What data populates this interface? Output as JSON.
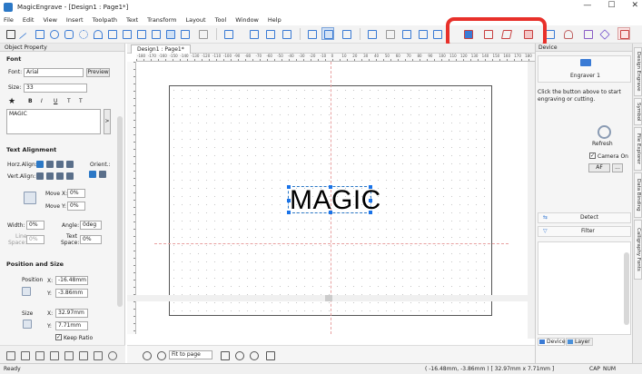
{
  "window": {
    "title": "MagicEngrave - [Design1 : Page1*]",
    "minimize": "—",
    "maximize": "☐",
    "close": "✕"
  },
  "menu": [
    "File",
    "Edit",
    "View",
    "Insert",
    "Toolpath",
    "Text",
    "Transform",
    "Layout",
    "Tool",
    "Window",
    "Help"
  ],
  "left_panel": {
    "title": "Object Property",
    "font_section": "Font",
    "font_label": "Font:",
    "font_value": "Arial",
    "preview_btn": "Preview",
    "size_label": "Size:",
    "size_value": "33",
    "style_b": "B",
    "style_i": "I",
    "style_u": "U",
    "style_t1": "T",
    "style_t2": "T",
    "text_value": "MAGIC",
    "more_btn": ">",
    "align_section": "Text Alignment",
    "horz_label": "Horz.Align:",
    "vert_label": "Vert.Align:",
    "orient_label": "Orient.:",
    "movex_label": "Move X:",
    "movex_value": "0%",
    "movey_label": "Move Y:",
    "movey_value": "0%",
    "width_label": "Width:",
    "width_value": "0%",
    "angle_label": "Angle:",
    "angle_value": "0deg",
    "linespace_label1": "Line",
    "linespace_label2": "Space:",
    "linespace_value": "0%",
    "textspace_label1": "Text",
    "textspace_label2": "Space:",
    "textspace_value": "0%",
    "pos_section": "Position and Size",
    "position_label": "Position",
    "posx_label": "X:",
    "posx_value": "-16.48mm",
    "posy_label": "Y:",
    "posy_value": "-3.86mm",
    "size2_label": "Size",
    "sizex_label": "X:",
    "sizex_value": "32.97mm",
    "sizey_label": "Y:",
    "sizey_value": "7.71mm",
    "keep_ratio": "Keep Ratio"
  },
  "document": {
    "tab": "Design1 : Page1*",
    "canvas_text": "MAGIC",
    "ruler_labels": [
      "-180",
      "-170",
      "-160",
      "-150",
      "-140",
      "-130",
      "-120",
      "-110",
      "-100",
      "-90",
      "-80",
      "-70",
      "-60",
      "-50",
      "-40",
      "-30",
      "-20",
      "-10",
      "0",
      "10",
      "20",
      "30",
      "40",
      "50",
      "60",
      "70",
      "80",
      "90",
      "100",
      "110",
      "120",
      "130",
      "140",
      "150",
      "160",
      "170",
      "180"
    ],
    "zoom_value": "Fit to page"
  },
  "right_panel": {
    "title": "Device",
    "engraver_label": "Engraver 1",
    "info_text": "Click the button above to start engraving or cutting.",
    "refresh_btn": "Refresh",
    "camera_on": "Camera On",
    "af_btn": "AF",
    "more_btn": "...",
    "detect_btn": "Detect",
    "filter_btn": "Filter",
    "device_tab": "Device",
    "layer_tab": "Layer"
  },
  "side_tabs": [
    "Design Engrave",
    "Symbol",
    "File Explorer",
    "Data Binding",
    "Calligraphy Fonts"
  ],
  "status": {
    "left": "Ready",
    "coords": "( -16.48mm, -3.86mm ) [ 32.97mm x 7.71mm ]",
    "cap": "CAP",
    "num": "NUM"
  }
}
